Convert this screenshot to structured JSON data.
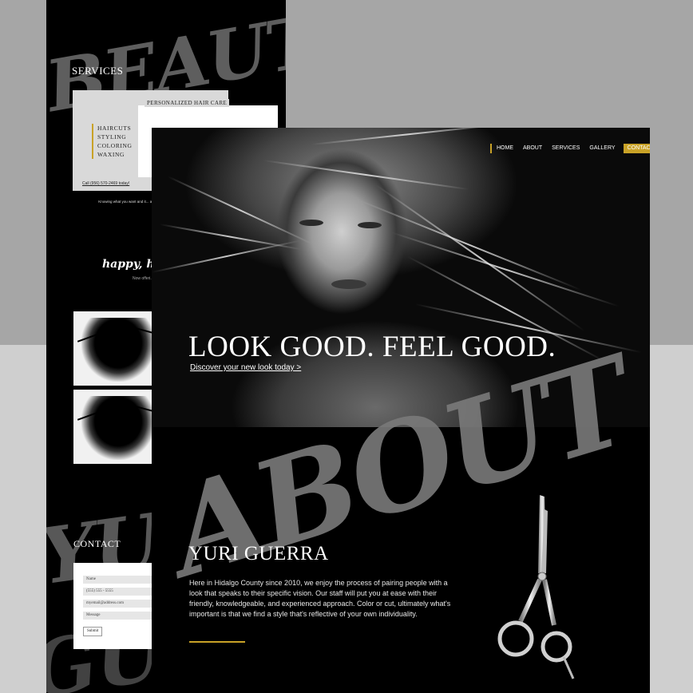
{
  "colors": {
    "accent": "#c9a227",
    "page_bg": "#000000",
    "brush_gray": "#7a7a7a"
  },
  "back_page": {
    "brush_words": [
      "BEAUTY",
      "YURI",
      "GUERRA"
    ],
    "services": {
      "title": "SERVICES",
      "card_title": "PERSONALIZED HAIR CARE",
      "items": [
        "HAIRCUTS",
        "STYLING",
        "COLORING",
        "WAXING"
      ],
      "call": "Call (956) 570-2469 today!"
    },
    "intro_text": "Knowing what you want and it... and your love life. Yuri Guerr...",
    "happy_heading": "happy, healthy",
    "happy_sub": "Now offeri...",
    "contact": {
      "title": "CONTACT",
      "fields": [
        "Name",
        "(555) 555 - 5555",
        "myemail@address.com",
        "Message"
      ],
      "submit": "Submit"
    }
  },
  "nav": {
    "items": [
      {
        "label": "HOME"
      },
      {
        "label": "ABOUT"
      },
      {
        "label": "SERVICES"
      },
      {
        "label": "GALLERY"
      },
      {
        "label": "CONTACT"
      }
    ]
  },
  "hero": {
    "title": "LOOK GOOD. FEEL GOOD.",
    "link": "Discover your new look today >"
  },
  "about": {
    "brush_word": "ABOUT",
    "name": "YURI GUERRA",
    "text": "Here in Hidalgo County since 2010, we enjoy the process of pairing people with a look that speaks to their specific vision. Our staff will put you at ease with their friendly, knowledgeable, and experienced approach. Color or cut, ultimately what's important is that we find a style that's reflective of your own individuality."
  },
  "icons": [
    "scissors-icon"
  ]
}
